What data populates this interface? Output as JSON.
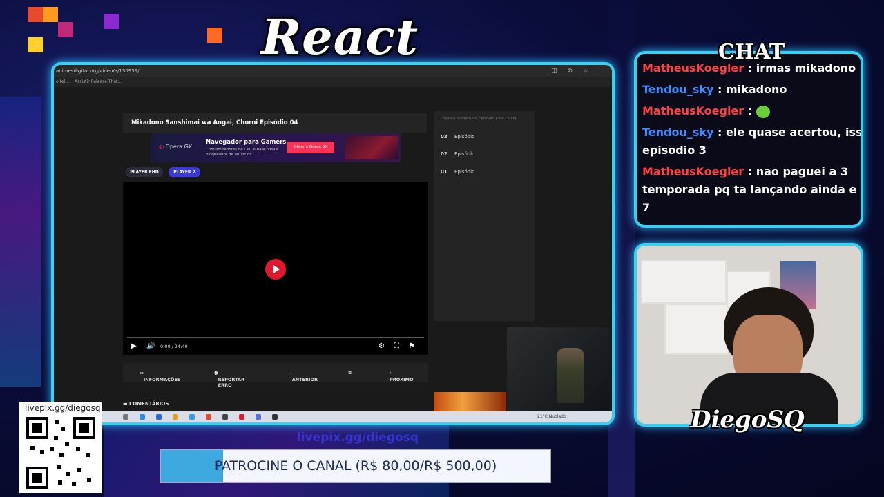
{
  "overlay": {
    "react_title": "React",
    "chat_title": "CHAT",
    "streamer_name": "DiegoSQ",
    "qr_label": "livepix.gg/diegosq",
    "donation_link": "livepix.gg/diegosq",
    "donation_goal_text": "PATROCINE O CANAL (R$ 80,00/R$ 500,00)",
    "donation_progress": 0.16
  },
  "browser": {
    "url": "animesdigital.org/video/a/130939/",
    "bookmarks": [
      "o tel...",
      "Assistir Release That..."
    ],
    "page_title": "Mikadono Sanshimai wa Angai, Choroi Episódio 04",
    "ad": {
      "brand": "Opera GX",
      "headline": "Navegador para Gamers",
      "subtext": "Com limitadores de CPU e RAM, VPN e bloqueador de anúncios",
      "button": "Obter o Opera GX"
    },
    "player_tabs": [
      "PLAYER FHD",
      "PLAYER 2"
    ],
    "player_time": "0:00 / 24:40",
    "nav": {
      "info": "INFORMAÇÕES",
      "report": "REPORTAR ERRO",
      "prev": "ANTERIOR",
      "next": "PRÓXIMO"
    },
    "comments_label": "COMENTÁRIOS",
    "episode_search_placeholder": "Digite o número do Episódio e de ENTER",
    "episodes": [
      {
        "num": "03",
        "label": "Episódio"
      },
      {
        "num": "02",
        "label": "Episódio"
      },
      {
        "num": "01",
        "label": "Episódio"
      }
    ],
    "taskbar": {
      "weather": "21°C  Nublado"
    }
  },
  "chat": {
    "messages": [
      {
        "user": "MatheusKoegler",
        "color": "red",
        "text": " : irmas mikadono"
      },
      {
        "user": "Tendou_sky",
        "color": "blue",
        "text": " : mikadono"
      },
      {
        "user": "MatheusKoegler",
        "color": "red",
        "text": " : "
      },
      {
        "user": "Tendou_sky",
        "color": "blue",
        "text": " : ele quase acertou, isso"
      },
      {
        "user": "MatheusKoegler",
        "color": "red",
        "text": " : nao paguei a 3"
      }
    ],
    "continuations": [
      "episodio 3",
      "temporada pq ta lançando ainda e ta no ep",
      "7"
    ]
  }
}
